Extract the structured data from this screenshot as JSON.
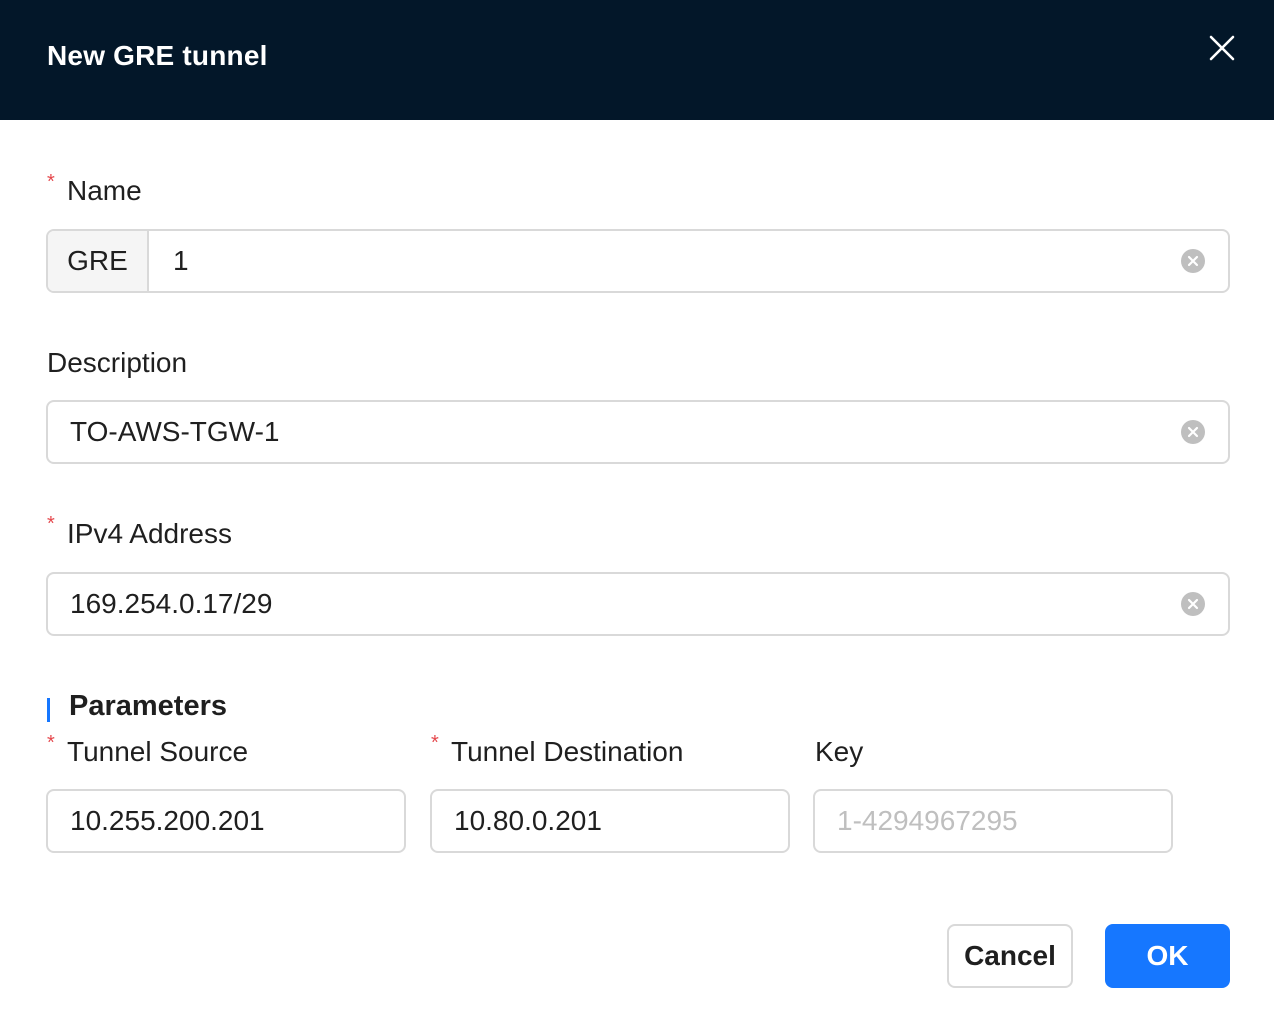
{
  "dialog": {
    "title": "New GRE tunnel"
  },
  "fields": {
    "name": {
      "label": "Name",
      "required": "*",
      "prefix": "GRE",
      "value": "1"
    },
    "description": {
      "label": "Description",
      "value": "TO-AWS-TGW-1"
    },
    "ipv4": {
      "label": "IPv4 Address",
      "required": "*",
      "value": "169.254.0.17/29"
    }
  },
  "parameters": {
    "title": "Parameters",
    "tunnel_source": {
      "label": "Tunnel Source",
      "required": "*",
      "value": "10.255.200.201"
    },
    "tunnel_destination": {
      "label": "Tunnel Destination",
      "required": "*",
      "value": "10.80.0.201"
    },
    "key": {
      "label": "Key",
      "value": "",
      "placeholder": "1-4294967295"
    }
  },
  "footer": {
    "cancel_label": "Cancel",
    "ok_label": "OK"
  },
  "colors": {
    "header_bg": "#031729",
    "primary": "#1677ff",
    "required": "#e5484d",
    "border": "#d9d9d9"
  },
  "icons": {
    "close": "close-icon",
    "clear": "clear-circle-icon"
  }
}
